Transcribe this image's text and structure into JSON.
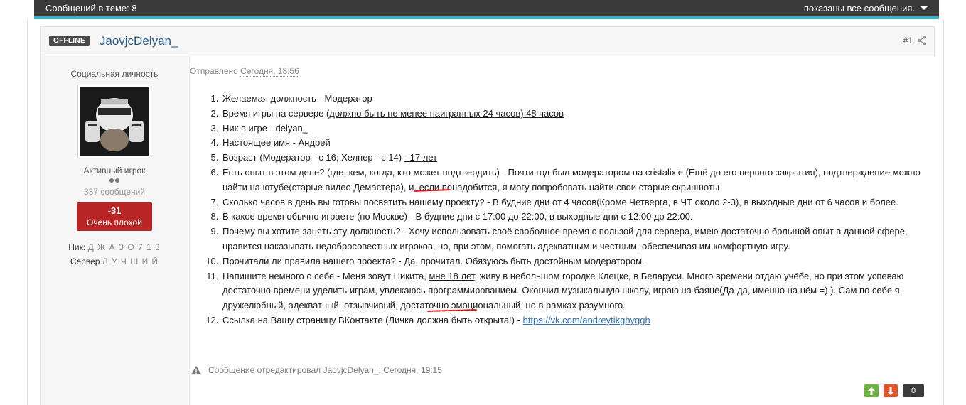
{
  "topbar": {
    "posts_in_topic": "Сообщений в теме: 8",
    "filter_label": "показаны все сообщения."
  },
  "post": {
    "status": "OFFLINE",
    "username": "JaovjcDelyan_",
    "number": "#1",
    "posted_prefix": "Отправлено",
    "posted_date": "Сегодня, 18:56",
    "author": {
      "role_title": "Социальная личность",
      "group": "Активный игрок",
      "post_count": "337 сообщений",
      "reputation_value": "-31",
      "reputation_label": "Очень плохой",
      "nick_label": "Ник:",
      "nick_value": "Д Ж А З О 7 1 3",
      "server_label": "Сервер",
      "server_value": "Л У Ч Ш И Й"
    },
    "items": {
      "i1": "Желаемая должность - Модератор",
      "i2_a": "Время игры на сервере (",
      "i2_b": "должно быть не менее наигранных 24 часов) 48 часов",
      "i3": "Ник в игре - delyan_",
      "i4": "Настоящее имя - Андрей",
      "i5_a": "Возраст  (Модератор - с 16; Хелпер - с 14) ",
      "i5_b": "- 17 лет",
      "i6": "Есть опыт в этом деле? (где, кем, когда, кто может подтвердить) - Почти год был модератором на cristalix'e (Ещё до его первого закрытия), подтверждение можно найти на ютубе(старые видео Демастера), и, если понадобится, я могу попробовать найти свои старые скриншоты",
      "i7": "Сколько часов в день вы готовы посвятить нашему проекту? - В будние дни от 4 часов(Кроме Четверга, в ЧТ около 2-3), в выходные дни от 6 часов и более.",
      "i8": "В какое время обычно играете (по Москве) - В будние дни с 17:00 до 22:00, в выходные дни с 12:00 до 22:00.",
      "i9": "Почему вы хотите занять эту должность? - Хочу использовать своё свободное время с пользой для сервера, имею достаточно большой опыт в данной сфере, нравится наказывать недобросовестных игроков, но, при этом, помогать адекватным и честным, обеспечивая им комфортную игру.",
      "i10": "Прочитали ли правила нашего проекта? - Да, прочитал. Обязуюсь быть достойным модератором.",
      "i11_a": "Напишите немного о себе - Меня зовут Никита, ",
      "i11_b": "мне 18 лет",
      "i11_c": ", живу в небольшом городке Клецке, в Беларуси. Много времени отдаю учёбе, но при этом успеваю достаточно времени уделить играм, увлекаюсь программированием. Окончил музыкальную школу, играю на баяне(Да-да, именно на нём =) ). Сам по себе я дружелюбный, адекватный, отзывчивый, достаточно эмоциональный, но в рамках разумного.",
      "i12_a": "Ссылка на Вашу страницу ВКонтакте (Личка должна быть открыта!) - ",
      "i12_link": "https://vk.com/andreytikghyggh"
    },
    "edited_note": "Сообщение отредактировал JaovjcDelyan_: Сегодня, 19:15",
    "vote_count": "0"
  },
  "colors": {
    "topbar_bg": "#3a3a3a",
    "topbar_accent": "#2fb1c9",
    "username": "#2a5f8a",
    "reputation_bg": "#b92424",
    "vote_up": "#6db33f",
    "vote_down": "#e4562a",
    "annotation_red": "#d81c1c"
  },
  "icons": [
    "caret-down-icon",
    "share-icon",
    "warning-icon",
    "arrow-up-icon",
    "arrow-down-icon"
  ]
}
